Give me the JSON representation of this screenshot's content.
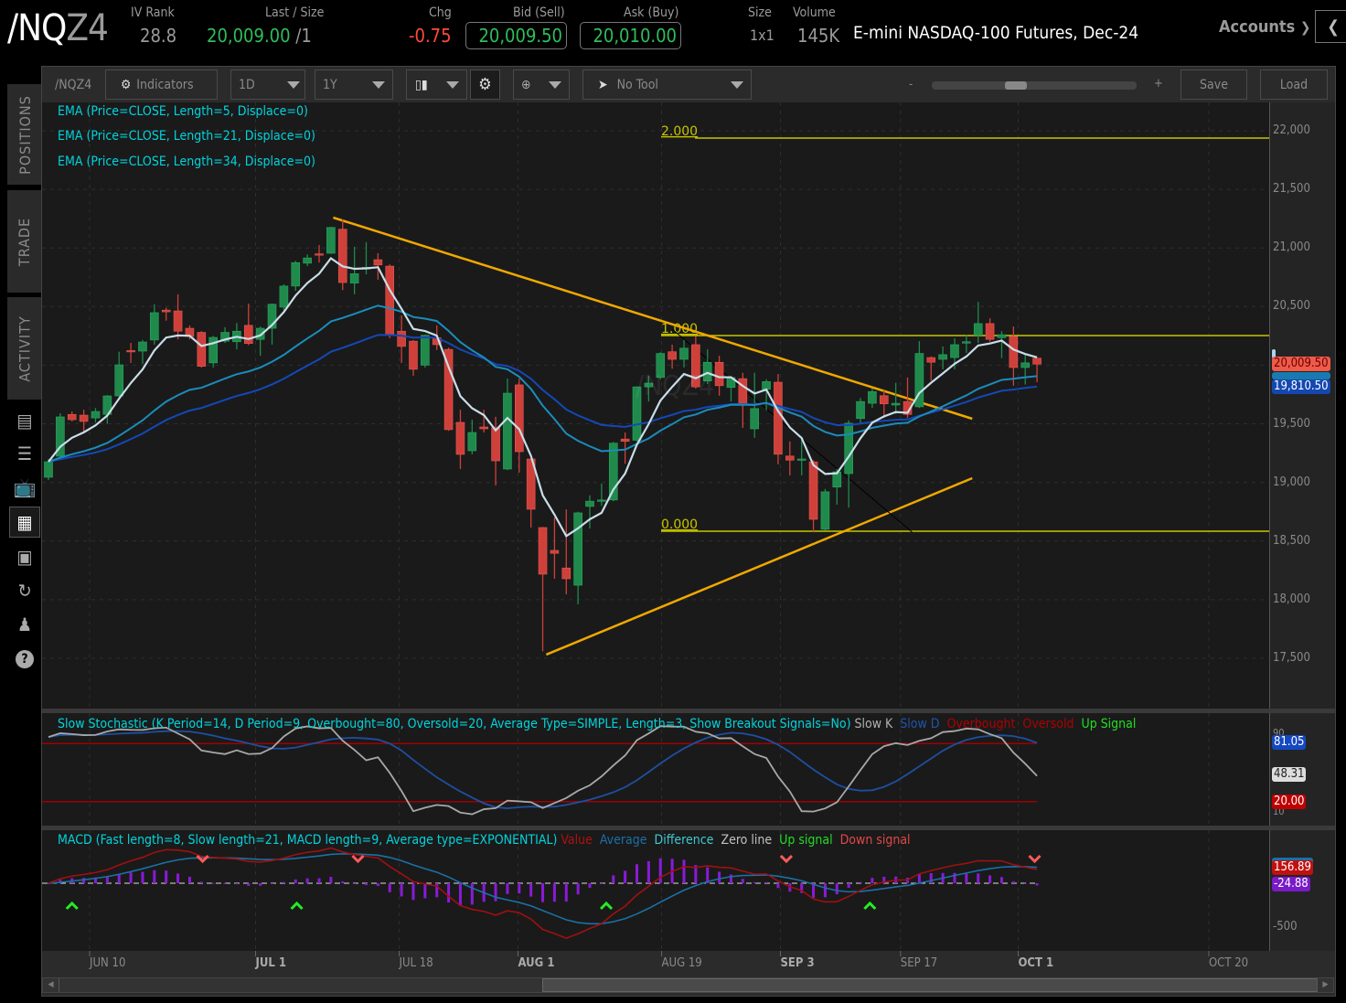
{
  "header": {
    "symbol_main": "/NQ",
    "symbol_suffix": "Z4",
    "iv_rank_label": "IV Rank",
    "iv_rank": "28.8",
    "last_label": "Last / Size",
    "last": "20,009.00",
    "last_size": "/1",
    "chg_label": "Chg",
    "chg": "-0.75",
    "bid_label": "Bid (Sell)",
    "bid": "20,009.50",
    "ask_label": "Ask (Buy)",
    "ask": "20,010.00",
    "size_label": "Size",
    "size": "1x1",
    "volume_label": "Volume",
    "volume": "145K",
    "description": "E-mini NASDAQ-100 Futures, Dec-24",
    "accounts": "Accounts"
  },
  "sidebar": {
    "tabs": [
      "POSITIONS",
      "TRADE",
      "ACTIVITY"
    ],
    "icons": [
      "news-icon",
      "list-icon",
      "tv-icon",
      "chart-icon",
      "grid-icon",
      "history-icon",
      "community-icon",
      "help-icon"
    ]
  },
  "toolbar": {
    "symbol": "/NQZ4",
    "indicators": "Indicators",
    "aggregation": "1D",
    "timeframe": "1Y",
    "drawing": "No Tool",
    "zoom_minus": "-",
    "zoom_plus": "+",
    "save": "Save",
    "load": "Load",
    "zoom_fraction": 0.4
  },
  "chart": {
    "watermark": "/NQZ4",
    "studies": [
      "EMA (Price=CLOSE, Length=5, Displace=0)",
      "EMA (Price=CLOSE, Length=21, Displace=0)",
      "EMA (Price=CLOSE, Length=34, Displace=0)"
    ],
    "colors": {
      "up": "#1f8a4c",
      "down": "#d0403a",
      "ema5": "#c9dde9",
      "ema21": "#1b8cbc",
      "ema34": "#1448b8",
      "fib": "#c8c400",
      "trend": "#f0a800"
    },
    "price_ticks": [
      "22,000",
      "21,500",
      "21,000",
      "20,500",
      "20,000",
      "19,500",
      "19,000",
      "18,500",
      "18,000",
      "17,500"
    ],
    "price_tick_values": [
      22000,
      21500,
      21000,
      20500,
      20000,
      19500,
      19000,
      18500,
      18000,
      17500
    ],
    "badges": {
      "last": "20,009.50",
      "ema34": "19,810.50"
    },
    "fib": [
      {
        "label": "2.000",
        "price": 21938
      },
      {
        "label": "1.000",
        "price": 20253
      },
      {
        "label": "0.000",
        "price": 18584
      }
    ],
    "trendlines": [
      {
        "from": [
          24.2,
          21259
        ],
        "to": [
          78.5,
          19543
        ],
        "color": "#f0a800"
      },
      {
        "from": [
          42.3,
          17531
        ],
        "to": [
          78.5,
          19036
        ],
        "color": "#f0a800"
      },
      {
        "from": [
          53,
          20307
        ],
        "to": [
          73.4,
          18575
        ],
        "color": "#000000"
      }
    ],
    "dates": [
      {
        "label": "JUN 10",
        "bar": 3.5,
        "bold": false
      },
      {
        "label": "JUL 1",
        "bar": 17.6,
        "bold": true
      },
      {
        "label": "JUL 18",
        "bar": 29.8,
        "bold": false
      },
      {
        "label": "AUG 1",
        "bar": 39.9,
        "bold": true
      },
      {
        "label": "AUG 19",
        "bar": 52.1,
        "bold": false
      },
      {
        "label": "SEP 3",
        "bar": 62.2,
        "bold": true
      },
      {
        "label": "SEP 17",
        "bar": 72.4,
        "bold": false
      },
      {
        "label": "OCT 1",
        "bar": 82.4,
        "bold": true
      },
      {
        "label": "OCT 20",
        "bar": 98.6,
        "bold": false
      }
    ],
    "candles": [
      [
        19044,
        19200,
        19020,
        19176
      ],
      [
        19223,
        19590,
        19200,
        19559
      ],
      [
        19580,
        19605,
        19520,
        19535
      ],
      [
        19574,
        19620,
        19434,
        19520
      ],
      [
        19550,
        19635,
        19510,
        19605
      ],
      [
        19580,
        19745,
        19500,
        19738
      ],
      [
        19738,
        20115,
        19730,
        20003
      ],
      [
        20125,
        20190,
        20020,
        20115
      ],
      [
        20120,
        20215,
        20010,
        20198
      ],
      [
        20215,
        20520,
        20175,
        20448
      ],
      [
        20470,
        20490,
        20380,
        20455
      ],
      [
        20463,
        20605,
        20220,
        20290
      ],
      [
        20315,
        20340,
        20220,
        20245
      ],
      [
        20280,
        20290,
        19980,
        19990
      ],
      [
        20020,
        20250,
        19980,
        20237
      ],
      [
        20205,
        20325,
        20190,
        20280
      ],
      [
        20200,
        20360,
        20135,
        20290
      ],
      [
        20340,
        20525,
        20170,
        20185
      ],
      [
        20220,
        20330,
        20080,
        20315
      ],
      [
        20315,
        20525,
        20175,
        20520
      ],
      [
        20495,
        20690,
        20470,
        20675
      ],
      [
        20675,
        20890,
        20635,
        20875
      ],
      [
        20870,
        20945,
        20845,
        20915
      ],
      [
        20950,
        21025,
        20875,
        20940
      ],
      [
        20955,
        21180,
        20950,
        21175
      ],
      [
        21160,
        21245,
        20640,
        20705
      ],
      [
        20700,
        21010,
        20605,
        20780
      ],
      [
        20820,
        21050,
        20775,
        20835
      ],
      [
        20900,
        20955,
        20730,
        20855
      ],
      [
        20845,
        20860,
        20230,
        20255
      ],
      [
        20290,
        20425,
        20020,
        20160
      ],
      [
        20205,
        20215,
        19910,
        19965
      ],
      [
        20000,
        20260,
        19980,
        20255
      ],
      [
        20235,
        20340,
        20130,
        20175
      ],
      [
        20135,
        20150,
        19440,
        19450
      ],
      [
        19512,
        19620,
        19114,
        19239
      ],
      [
        19270,
        19535,
        19239,
        19426
      ],
      [
        19473,
        19620,
        19426,
        19457
      ],
      [
        19465,
        19560,
        18974,
        19184
      ],
      [
        19114,
        19886,
        19105,
        19761
      ],
      [
        19832,
        19886,
        19083,
        19262
      ],
      [
        19200,
        19205,
        18615,
        18771
      ],
      [
        18615,
        18620,
        17560,
        18217
      ],
      [
        18420,
        18700,
        18178,
        18395
      ],
      [
        18270,
        18770,
        18045,
        18178
      ],
      [
        18123,
        18750,
        17960,
        18740
      ],
      [
        18795,
        18890,
        18607,
        18840
      ],
      [
        18840,
        18990,
        18800,
        18850
      ],
      [
        18850,
        19345,
        18840,
        19335
      ],
      [
        19370,
        19426,
        19160,
        19350
      ],
      [
        19360,
        19820,
        19350,
        19815
      ],
      [
        19815,
        19910,
        19690,
        19847
      ],
      [
        19895,
        20110,
        19880,
        20100
      ],
      [
        20115,
        20175,
        19970,
        20050
      ],
      [
        20050,
        20215,
        19980,
        20145
      ],
      [
        20175,
        20245,
        19800,
        19815
      ],
      [
        19865,
        20135,
        19840,
        20025
      ],
      [
        20025,
        20080,
        19740,
        19825
      ],
      [
        19810,
        19900,
        19690,
        19895
      ],
      [
        19885,
        19935,
        19465,
        19675
      ],
      [
        19457,
        19935,
        19380,
        19630
      ],
      [
        19795,
        19880,
        19615,
        19860
      ],
      [
        19855,
        19925,
        19155,
        19240
      ],
      [
        19225,
        19350,
        19060,
        19190
      ],
      [
        19190,
        19390,
        19060,
        19200
      ],
      [
        19175,
        19190,
        18575,
        18685
      ],
      [
        18600,
        18945,
        18590,
        18920
      ],
      [
        18960,
        19115,
        18810,
        19090
      ],
      [
        19075,
        19530,
        18785,
        19505
      ],
      [
        19545,
        19720,
        19505,
        19690
      ],
      [
        19675,
        19800,
        19635,
        19775
      ],
      [
        19740,
        19785,
        19550,
        19670
      ],
      [
        19660,
        19850,
        19585,
        19675
      ],
      [
        19690,
        19895,
        19550,
        19580
      ],
      [
        19645,
        20205,
        19635,
        20100
      ],
      [
        20065,
        20075,
        19870,
        20025
      ],
      [
        20050,
        20160,
        19965,
        20090
      ],
      [
        20065,
        20230,
        19965,
        20175
      ],
      [
        20190,
        20255,
        20105,
        20200
      ],
      [
        20255,
        20540,
        20190,
        20355
      ],
      [
        20355,
        20400,
        20200,
        20220
      ],
      [
        20235,
        20290,
        20060,
        20260
      ],
      [
        20245,
        20330,
        19825,
        19980
      ],
      [
        19980,
        20090,
        19835,
        20020
      ],
      [
        20060,
        20065,
        19855,
        20009
      ]
    ]
  },
  "stoch": {
    "title": "Slow Stochastic (K Period=14, D Period=9, Overbought=80, Oversold=20, Average Type=SIMPLE, Length=3, Show Breakout Signals=No)",
    "legend": [
      {
        "label": "Slow K",
        "color": "#b0b0b0"
      },
      {
        "label": "Slow D",
        "color": "#1e54b0"
      },
      {
        "label": "Overbought",
        "color": "#b00000"
      },
      {
        "label": "Oversold",
        "color": "#b00000"
      },
      {
        "label": "Up Signal",
        "color": "#22dd22"
      }
    ],
    "overbought": 80,
    "oversold": 20,
    "badges": {
      "d": "81.05",
      "k": "48.31",
      "os": "20.00"
    },
    "ticks": {
      "top": "90",
      "bottom": "10"
    }
  },
  "macd": {
    "title": "MACD (Fast length=8, Slow length=21, MACD length=9, Average type=EXPONENTIAL)",
    "legend": [
      {
        "label": "Value",
        "color": "#b01010"
      },
      {
        "label": "Average",
        "color": "#1a70a8"
      },
      {
        "label": "Difference",
        "color": "#40c8d0"
      },
      {
        "label": "Zero line",
        "color": "#c0c0c0"
      },
      {
        "label": "Up signal",
        "color": "#22dd22"
      },
      {
        "label": "Down signal",
        "color": "#e04848"
      }
    ],
    "badges": {
      "value": "156.89",
      "diff": "-24.88"
    },
    "tick": "-500",
    "down_signals": [
      13.1,
      26.3,
      62.7,
      83.8
    ],
    "up_signals": [
      2,
      21.1,
      47.4,
      69.8
    ]
  }
}
